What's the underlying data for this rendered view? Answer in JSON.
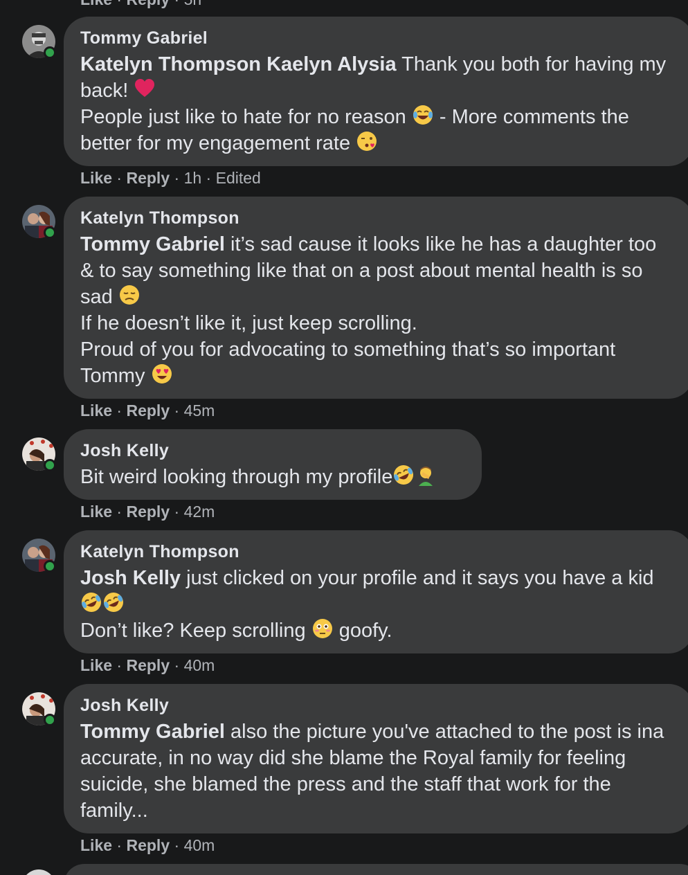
{
  "top_partial": {
    "like": "Like",
    "reply": "Reply",
    "time": "5h"
  },
  "comments": [
    {
      "author": "Tommy Gabriel",
      "line1_mention": "Katelyn Thompson Kaelyn Alysia",
      "line1_text": " Thank you both for having my back! ",
      "line2_text": "People just like to hate for no reason ",
      "line2_after": " - More comments the better for my engagement rate ",
      "like": "Like",
      "reply": "Reply",
      "time": "1h",
      "edited": "Edited"
    },
    {
      "author": "Katelyn Thompson",
      "line1_mention": "Tommy Gabriel",
      "line1_text": " it’s sad cause it looks like he has a daughter too & to say something like that on a post about mental health is so sad ",
      "line2_text": "If he doesn’t like it, just keep scrolling.",
      "line3_text": "Proud of you for advocating to something that’s so important Tommy ",
      "like": "Like",
      "reply": "Reply",
      "time": "45m"
    },
    {
      "author": "Josh Kelly",
      "line1_text": "Bit weird looking through my profile",
      "like": "Like",
      "reply": "Reply",
      "time": "42m"
    },
    {
      "author": "Katelyn Thompson",
      "line1_mention": "Josh Kelly",
      "line1_text": " just clicked on your profile and it says you have a kid ",
      "line2_text": "Don’t like? Keep scrolling ",
      "line2_after": " goofy.",
      "like": "Like",
      "reply": "Reply",
      "time": "40m"
    },
    {
      "author": "Josh Kelly",
      "line1_mention": "Tommy Gabriel",
      "line1_text": " also the picture you've attached to the post is ina accurate, in no way did she blame the Royal family for feeling suicide, she blamed the press and the staff that work for the family...",
      "like": "Like",
      "reply": "Reply",
      "time": "40m"
    }
  ],
  "colors": {
    "background": "#18191a",
    "bubble": "#3a3b3c",
    "text": "#e4e6eb",
    "secondary_text": "#b0b3b8",
    "online": "#31a24c"
  },
  "icons": {
    "heart": "red-heart-icon",
    "tears_of_joy": "face-with-tears-of-joy-icon",
    "kiss": "face-blowing-kiss-icon",
    "disappointed": "disappointed-face-icon",
    "heart_eyes": "heart-eyes-face-icon",
    "rofl": "rolling-on-floor-laughing-icon",
    "facepalm": "man-facepalming-icon",
    "flushed": "flushed-face-icon"
  }
}
